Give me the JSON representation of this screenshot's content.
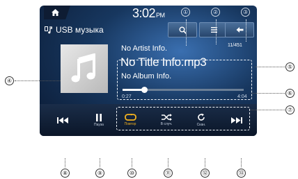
{
  "clock": {
    "time": "3:02",
    "ampm": "PM"
  },
  "source": {
    "label": "USB музыка"
  },
  "track": {
    "artist": "No Artist Info.",
    "title": "No Title Info.mp3",
    "album": "No Album Info.",
    "counter": "11/451",
    "elapsed": "0:27",
    "duration": "4:04",
    "progress_fraction": 0.18
  },
  "controls": {
    "pause_label": "Пауза",
    "repeat_label": "Повтор",
    "shuffle_label": "В случ.",
    "scan_label": "Скан."
  },
  "colors": {
    "accent": "#f3b21f",
    "screen_bg": "#17375f"
  },
  "icons": [
    "home-icon",
    "usb-music-icon",
    "search-icon",
    "list-icon",
    "back-icon",
    "music-note-icon",
    "previous-track-icon",
    "pause-icon",
    "repeat-icon",
    "shuffle-icon",
    "scan-icon",
    "next-track-icon"
  ],
  "callouts": {
    "c1": "①",
    "c2": "②",
    "c3": "③",
    "c4": "④",
    "c5": "⑤",
    "c6": "⑥",
    "c7": "⑦",
    "c8": "⑧",
    "c9": "⑨",
    "c10": "⑩",
    "c11": "⑪",
    "c12": "⑫",
    "c13": "⑬"
  }
}
